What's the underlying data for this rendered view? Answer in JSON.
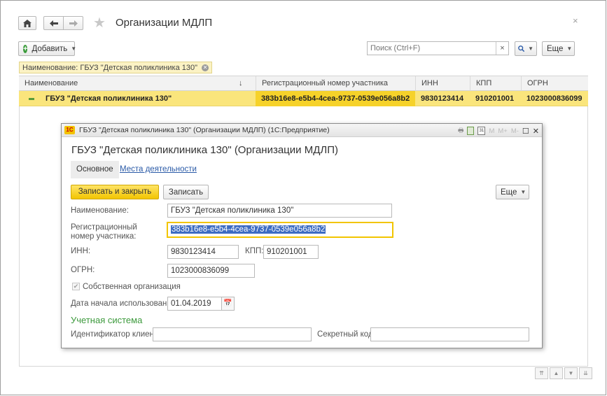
{
  "nav": {
    "home_icon": "home-icon",
    "back_icon": "arrow-left-icon",
    "forward_icon": "arrow-right-icon",
    "favorite_icon": "star-icon"
  },
  "page": {
    "title": "Организации МДЛП",
    "close_label": "×"
  },
  "toolbar": {
    "add_label": "Добавить",
    "search_placeholder": "Поиск (Ctrl+F)",
    "search_clear": "×",
    "more_label": "Еще"
  },
  "filter": {
    "text": "Наименование: ГБУЗ \"Детская поликлиника 130\""
  },
  "table": {
    "columns": [
      "Наименование",
      "Регистрационный номер участника",
      "ИНН",
      "КПП",
      "ОГРН"
    ],
    "sort_indicator": "↓",
    "rows": [
      {
        "name": "ГБУЗ \"Детская поликлиника 130\"",
        "reg_number": "383b16e8-e5b4-4cea-9737-0539e056a8b2",
        "inn": "9830123414",
        "kpp": "910201001",
        "ogrn": "1023000836099"
      }
    ]
  },
  "modal": {
    "window_title": "ГБУЗ \"Детская поликлиника 130\" (Организации МДЛП)  (1С:Предприятие)",
    "logo_text": "1C",
    "header_icons": [
      "M",
      "M+",
      "M-"
    ],
    "title": "ГБУЗ \"Детская поликлиника 130\" (Организации МДЛП)",
    "tabs": {
      "main": "Основное",
      "places": "Места деятельности"
    },
    "buttons": {
      "save_close": "Записать и закрыть",
      "save": "Записать",
      "more": "Еще"
    },
    "fields": {
      "name_label": "Наименование:",
      "name_value": "ГБУЗ \"Детская поликлиника 130\"",
      "reg_label_line1": "Регистрационный",
      "reg_label_line2": "номер участника:",
      "reg_value": "383b16e8-e5b4-4cea-9737-0539e056a8b2",
      "inn_label": "ИНН:",
      "inn_value": "9830123414",
      "kpp_label": "КПП:",
      "kpp_value": "910201001",
      "ogrn_label": "ОГРН:",
      "ogrn_value": "1023000836099",
      "own_org_label": "Собственная организация",
      "own_org_checked": true,
      "date_label": "Дата начала использования:",
      "date_value": "01.04.2019"
    },
    "accounting": {
      "section_title": "Учетная система",
      "client_id_label": "Идентификатор клиента:",
      "client_id_value": "",
      "secret_code_label": "Секретный код:",
      "secret_code_value": ""
    }
  },
  "colors": {
    "accent_yellow": "#f2c500",
    "selected_row": "#fae57c",
    "section_green": "#3d9a3d",
    "link_blue": "#2a5aa7"
  }
}
